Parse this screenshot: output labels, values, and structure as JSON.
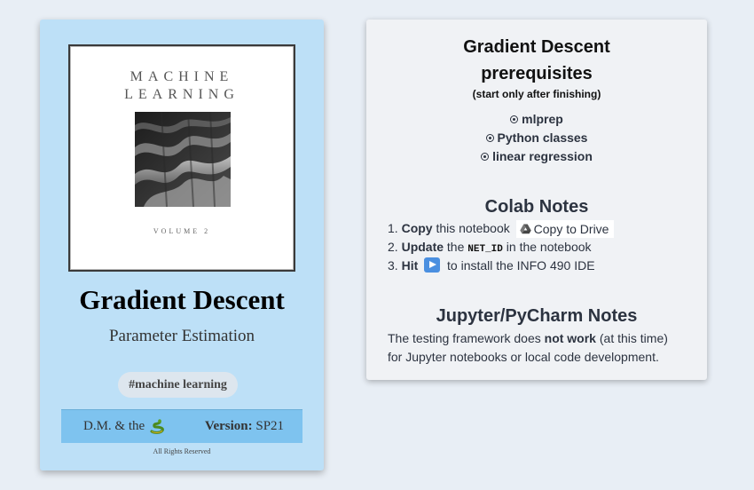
{
  "book": {
    "cover_title_line1": "MACHINE",
    "cover_title_line2": "LEARNING",
    "cover_volume": "VOLUME 2",
    "title": "Gradient Descent",
    "subtitle": "Parameter Estimation",
    "tag": "#machine learning",
    "author": "D.M. & the",
    "version_label": "Version:",
    "version_value": "SP21",
    "rights": "All Rights Reserved"
  },
  "prereqs": {
    "title_line1": "Gradient Descent",
    "title_line2": "prerequisites",
    "note": "(start only after finishing)",
    "items": [
      "mlprep",
      "Python classes",
      "linear regression"
    ]
  },
  "colab": {
    "title": "Colab Notes",
    "step1_num": "1.",
    "step1_bold": "Copy",
    "step1_text": "this notebook",
    "copy_button": "Copy to Drive",
    "step2_num": "2.",
    "step2_bold": "Update",
    "step2_text_a": "the",
    "step2_code": "NET_ID",
    "step2_text_b": "in the notebook",
    "step3_num": "3.",
    "step3_bold": "Hit",
    "step3_text": "to install the INFO 490 IDE"
  },
  "jupyter": {
    "title": "Jupyter/PyCharm Notes",
    "text_a": "The testing framework does",
    "text_bold": "not work",
    "text_b": "(at this time)",
    "text_c": "for Jupyter notebooks or local code development."
  },
  "colors": {
    "book_card_bg": "#bde0f7",
    "footer_bar_bg": "#7ec3ef",
    "page_bg": "#e8eef5",
    "play_button": "#4a8fe0"
  },
  "icons": {
    "radio": "radio-dot-icon",
    "drive": "google-drive-icon",
    "play": "play-button-icon",
    "snake": "snake-emoji-icon"
  }
}
